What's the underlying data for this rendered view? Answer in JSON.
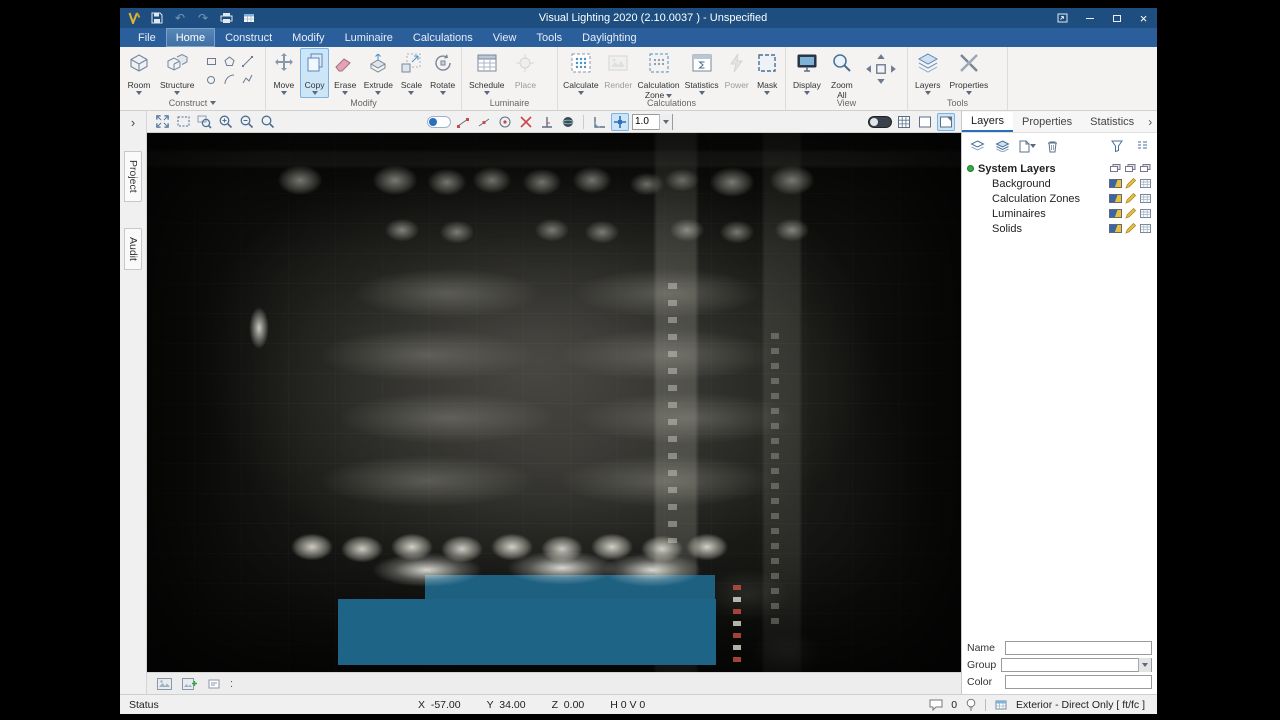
{
  "icons": {
    "undo": "↶",
    "redo": "↷",
    "close": "×",
    "chevron_expand": "›",
    "panel_chevron": "›",
    "colon": ":"
  },
  "colors": {
    "titlebar": "#1d4e7f",
    "menubar": "#2b5f9c",
    "accent": "#2a6fbd",
    "ribbon_active": "#cde6f7",
    "building": "#1e6486"
  },
  "titlebar": {
    "title": "Visual Lighting 2020 (2.10.0037 ) - Unspecified"
  },
  "menubar": {
    "active_tab": "Home",
    "tabs": [
      {
        "label": "File"
      },
      {
        "label": "Home"
      },
      {
        "label": "Construct"
      },
      {
        "label": "Modify"
      },
      {
        "label": "Luminaire"
      },
      {
        "label": "Calculations"
      },
      {
        "label": "View"
      },
      {
        "label": "Tools"
      },
      {
        "label": "Daylighting"
      }
    ]
  },
  "ribbon": {
    "construct": {
      "group_label": "Construct",
      "room": "Room",
      "structure": "Structure"
    },
    "modify": {
      "group_label": "Modify",
      "move": "Move",
      "copy": "Copy",
      "erase": "Erase",
      "extrude": "Extrude",
      "scale": "Scale",
      "rotate": "Rotate",
      "active_tool": "Copy"
    },
    "luminaire": {
      "group_label": "Luminaire",
      "schedule": "Schedule",
      "place": "Place"
    },
    "calculations": {
      "group_label": "Calculations",
      "calculate": "Calculate",
      "render": "Render",
      "calc_zone_line1": "Calculation",
      "calc_zone_line2": "Zone",
      "statistics": "Statistics",
      "power": "Power",
      "mask": "Mask"
    },
    "view": {
      "group_label": "View",
      "display": "Display",
      "zoom_line1": "Zoom",
      "zoom_line2": "All"
    },
    "tools": {
      "group_label": "Tools",
      "layers": "Layers",
      "properties": "Properties"
    }
  },
  "toolbar": {
    "scale_value": "1.0"
  },
  "side_tabs": {
    "project": "Project",
    "audit": "Audit"
  },
  "right_panel": {
    "active_tab": "Layers",
    "tabs": [
      {
        "label": "Layers"
      },
      {
        "label": "Properties"
      },
      {
        "label": "Statistics"
      }
    ],
    "tree": {
      "root": "System Layers",
      "items": [
        {
          "label": "Background"
        },
        {
          "label": "Calculation Zones"
        },
        {
          "label": "Luminaires"
        },
        {
          "label": "Solids"
        }
      ]
    },
    "form": {
      "name_label": "Name",
      "group_label": "Group",
      "color_label": "Color"
    }
  },
  "statusbar": {
    "status": "Status",
    "x": "X  -57.00",
    "y": "Y  34.00",
    "z": "Z  0.00",
    "hv": "H 0 V 0",
    "bubble_count": "0",
    "mode": "Exterior - Direct Only [ ft/fc ]"
  }
}
